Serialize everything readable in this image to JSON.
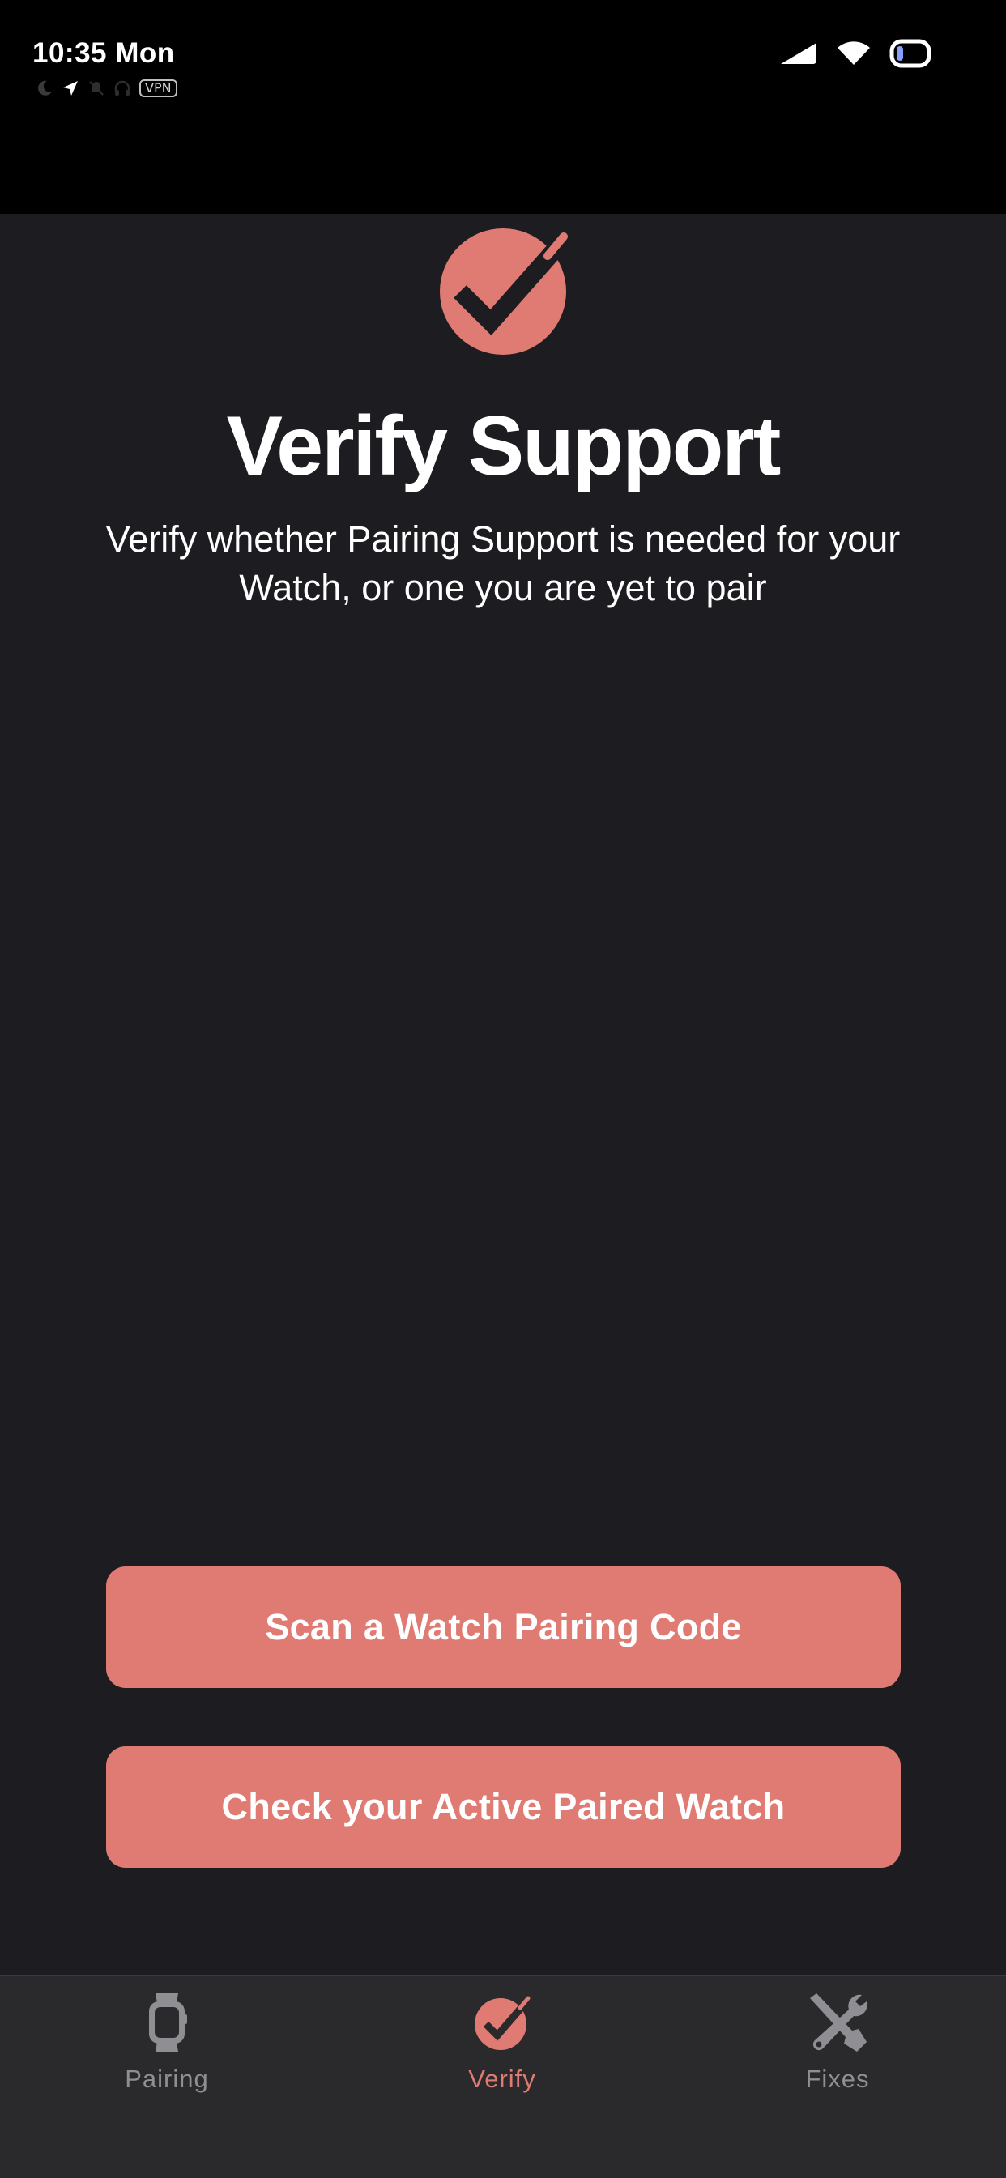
{
  "status_bar": {
    "time": "10:35 Mon",
    "vpn_label": "VPN",
    "icons": [
      "moon-icon",
      "location-arrow-icon",
      "bell-slash-icon",
      "headphones-icon",
      "cellular-signal-icon",
      "wifi-icon",
      "battery-icon"
    ]
  },
  "hero": {
    "icon": "checkmark-circle-icon",
    "title": "Verify Support",
    "subtitle": "Verify whether Pairing Support is needed for your Watch, or one you are yet to pair"
  },
  "actions": {
    "scan_label": "Scan a Watch Pairing Code",
    "check_label": "Check your Active Paired Watch"
  },
  "tab_bar": {
    "items": [
      {
        "label": "Pairing",
        "icon": "watch-icon",
        "active": false
      },
      {
        "label": "Verify",
        "icon": "checkmark-circle-icon",
        "active": true
      },
      {
        "label": "Fixes",
        "icon": "wrench-screwdriver-icon",
        "active": false
      }
    ]
  },
  "colors": {
    "accent": "#e07b73",
    "background": "#1c1c21",
    "status_bar_bg": "#000000",
    "tab_bar_bg": "#2a2a2d",
    "inactive_tab": "#8e8e93"
  }
}
